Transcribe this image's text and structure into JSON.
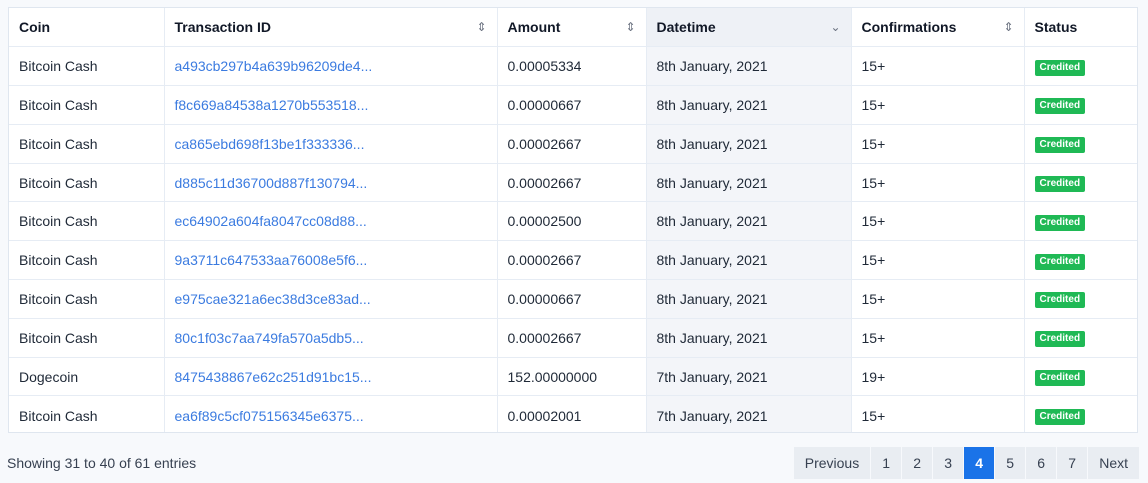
{
  "table": {
    "headers": {
      "coin": "Coin",
      "txid": "Transaction ID",
      "amount": "Amount",
      "datetime": "Datetime",
      "confirmations": "Confirmations",
      "status": "Status"
    },
    "sort_icons": {
      "txid": "⇕",
      "amount": "⇕",
      "datetime": "⌄",
      "confirmations": "⇕"
    },
    "rows": [
      {
        "coin": "Bitcoin Cash",
        "txid": "a493cb297b4a639b96209de4...",
        "amount": "0.00005334",
        "datetime": "8th January, 2021",
        "confirmations": "15+",
        "status": "Credited"
      },
      {
        "coin": "Bitcoin Cash",
        "txid": "f8c669a84538a1270b553518...",
        "amount": "0.00000667",
        "datetime": "8th January, 2021",
        "confirmations": "15+",
        "status": "Credited"
      },
      {
        "coin": "Bitcoin Cash",
        "txid": "ca865ebd698f13be1f333336...",
        "amount": "0.00002667",
        "datetime": "8th January, 2021",
        "confirmations": "15+",
        "status": "Credited"
      },
      {
        "coin": "Bitcoin Cash",
        "txid": "d885c11d36700d887f130794...",
        "amount": "0.00002667",
        "datetime": "8th January, 2021",
        "confirmations": "15+",
        "status": "Credited"
      },
      {
        "coin": "Bitcoin Cash",
        "txid": "ec64902a604fa8047cc08d88...",
        "amount": "0.00002500",
        "datetime": "8th January, 2021",
        "confirmations": "15+",
        "status": "Credited"
      },
      {
        "coin": "Bitcoin Cash",
        "txid": "9a3711c647533aa76008e5f6...",
        "amount": "0.00002667",
        "datetime": "8th January, 2021",
        "confirmations": "15+",
        "status": "Credited"
      },
      {
        "coin": "Bitcoin Cash",
        "txid": "e975cae321a6ec38d3ce83ad...",
        "amount": "0.00000667",
        "datetime": "8th January, 2021",
        "confirmations": "15+",
        "status": "Credited"
      },
      {
        "coin": "Bitcoin Cash",
        "txid": "80c1f03c7aa749fa570a5db5...",
        "amount": "0.00002667",
        "datetime": "8th January, 2021",
        "confirmations": "15+",
        "status": "Credited"
      },
      {
        "coin": "Dogecoin",
        "txid": "8475438867e62c251d91bc15...",
        "amount": "152.00000000",
        "datetime": "7th January, 2021",
        "confirmations": "19+",
        "status": "Credited"
      },
      {
        "coin": "Bitcoin Cash",
        "txid": "ea6f89c5cf075156345e6375...",
        "amount": "0.00002001",
        "datetime": "7th January, 2021",
        "confirmations": "15+",
        "status": "Credited"
      }
    ]
  },
  "footer": {
    "info": "Showing 31 to 40 of 61 entries"
  },
  "pagination": {
    "previous": "Previous",
    "next": "Next",
    "pages": [
      "1",
      "2",
      "3",
      "4",
      "5",
      "6",
      "7"
    ],
    "current": "4"
  },
  "colors": {
    "link": "#3b7be0",
    "badge": "#1fb955",
    "active_page": "#1a73e8"
  }
}
